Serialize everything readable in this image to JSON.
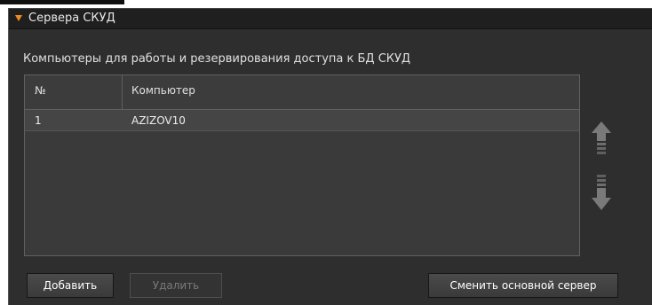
{
  "panel": {
    "title": "Сервера СКУД",
    "group_label": "Компьютеры для работы и резервирования доступа к БД СКУД",
    "accent_color": "#f08a1a"
  },
  "table": {
    "columns": [
      "№",
      "Компьютер"
    ],
    "rows": [
      {
        "num": "1",
        "computer": "AZIZOV10"
      }
    ]
  },
  "icons": {
    "collapse": "triangle-down-icon",
    "move_up": "arrow-up-icon",
    "move_down": "arrow-down-icon"
  },
  "buttons": {
    "add": "Добавить",
    "delete": "Удалить",
    "change_main": "Сменить основной сервер"
  }
}
